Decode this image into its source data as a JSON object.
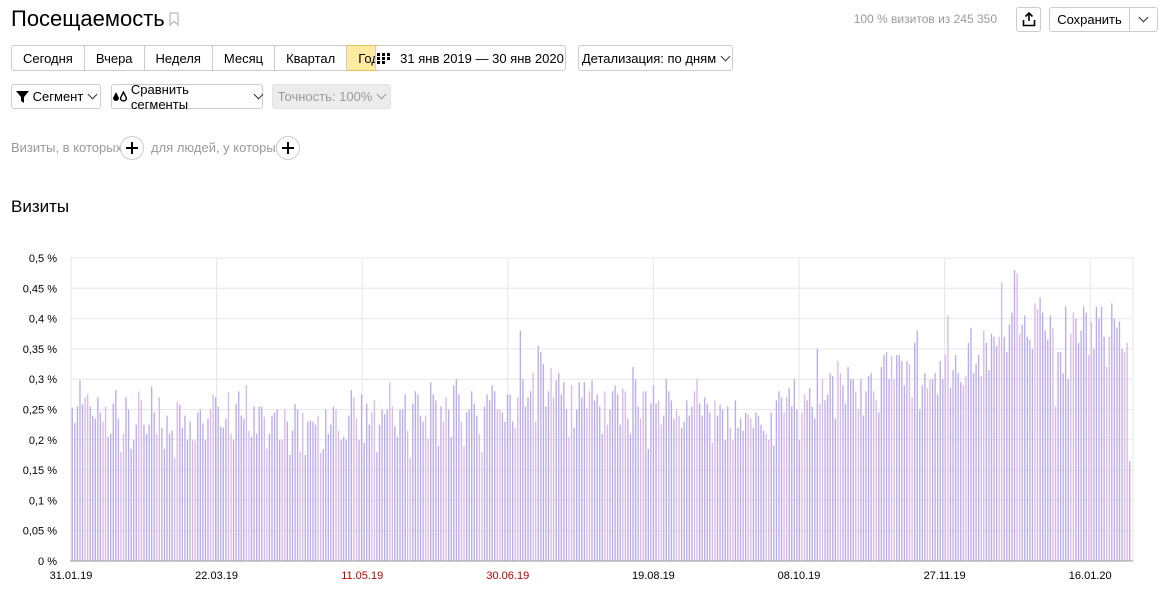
{
  "header": {
    "title": "Посещаемость",
    "visits_info": "100 % визитов из 245 350",
    "save_label": "Сохранить"
  },
  "periods": {
    "items": [
      {
        "label": "Сегодня",
        "active": false
      },
      {
        "label": "Вчера",
        "active": false
      },
      {
        "label": "Неделя",
        "active": false
      },
      {
        "label": "Месяц",
        "active": false
      },
      {
        "label": "Квартал",
        "active": false
      },
      {
        "label": "Год",
        "active": true
      }
    ]
  },
  "date_range": "31 янв 2019 — 30 янв 2020",
  "detail": "Детализация: по дням",
  "segment_label": "Сегмент",
  "compare_label": "Сравнить сегменты",
  "accuracy_label": "Точность: 100%",
  "filters": {
    "visits_label": "Визиты, в которых",
    "people_label": "для людей, у которых"
  },
  "section_title": "Визиты",
  "chart_data": {
    "type": "bar",
    "series": [
      {
        "name": "Визиты"
      }
    ],
    "y_unit": "%",
    "ylim": [
      0,
      0.5
    ],
    "yticks": [
      "0 %",
      "0,05 %",
      "0,1 %",
      "0,15 %",
      "0,2 %",
      "0,25 %",
      "0,3 %",
      "0,35 %",
      "0,4 %",
      "0,45 %",
      "0,5 %"
    ],
    "x_ticks": [
      {
        "label": "31.01.19",
        "holiday": false
      },
      {
        "label": "22.03.19",
        "holiday": false
      },
      {
        "label": "11.05.19",
        "holiday": true
      },
      {
        "label": "30.06.19",
        "holiday": true
      },
      {
        "label": "19.08.19",
        "holiday": false
      },
      {
        "label": "08.10.19",
        "holiday": false
      },
      {
        "label": "27.11.19",
        "holiday": false
      },
      {
        "label": "16.01.20",
        "holiday": false
      }
    ],
    "grid": true,
    "values": [
      0.253,
      0.228,
      0.255,
      0.298,
      0.258,
      0.27,
      0.275,
      0.255,
      0.24,
      0.235,
      0.27,
      0.245,
      0.23,
      0.255,
      0.205,
      0.21,
      0.26,
      0.282,
      0.235,
      0.18,
      0.21,
      0.27,
      0.25,
      0.185,
      0.2,
      0.225,
      0.28,
      0.265,
      0.225,
      0.21,
      0.225,
      0.288,
      0.245,
      0.21,
      0.27,
      0.22,
      0.185,
      0.24,
      0.21,
      0.215,
      0.17,
      0.262,
      0.258,
      0.22,
      0.24,
      0.2,
      0.23,
      0.2,
      0.198,
      0.245,
      0.25,
      0.227,
      0.2,
      0.235,
      0.25,
      0.275,
      0.27,
      0.255,
      0.222,
      0.22,
      0.235,
      0.278,
      0.21,
      0.2,
      0.26,
      0.28,
      0.24,
      0.235,
      0.29,
      0.215,
      0.205,
      0.255,
      0.21,
      0.255,
      0.255,
      0.238,
      0.185,
      0.21,
      0.24,
      0.245,
      0.25,
      0.2,
      0.2,
      0.25,
      0.23,
      0.175,
      0.215,
      0.259,
      0.25,
      0.18,
      0.245,
      0.175,
      0.23,
      0.232,
      0.23,
      0.225,
      0.24,
      0.178,
      0.185,
      0.25,
      0.21,
      0.225,
      0.255,
      0.25,
      0.215,
      0.2,
      0.205,
      0.2,
      0.24,
      0.282,
      0.27,
      0.235,
      0.2,
      0.275,
      0.195,
      0.26,
      0.225,
      0.245,
      0.265,
      0.18,
      0.225,
      0.25,
      0.242,
      0.25,
      0.295,
      0.255,
      0.222,
      0.205,
      0.25,
      0.25,
      0.275,
      0.215,
      0.17,
      0.26,
      0.28,
      0.275,
      0.24,
      0.23,
      0.24,
      0.202,
      0.295,
      0.275,
      0.265,
      0.19,
      0.255,
      0.23,
      0.27,
      0.25,
      0.205,
      0.29,
      0.3,
      0.275,
      0.23,
      0.19,
      0.245,
      0.25,
      0.28,
      0.26,
      0.24,
      0.21,
      0.18,
      0.255,
      0.275,
      0.265,
      0.29,
      0.28,
      0.25,
      0.25,
      0.245,
      0.23,
      0.275,
      0.275,
      0.23,
      0.22,
      0.27,
      0.38,
      0.3,
      0.255,
      0.27,
      0.28,
      0.31,
      0.23,
      0.355,
      0.345,
      0.325,
      0.255,
      0.28,
      0.318,
      0.27,
      0.298,
      0.31,
      0.275,
      0.295,
      0.25,
      0.205,
      0.29,
      0.22,
      0.25,
      0.295,
      0.27,
      0.295,
      0.252,
      0.28,
      0.298,
      0.265,
      0.275,
      0.255,
      0.21,
      0.28,
      0.225,
      0.25,
      0.28,
      0.29,
      0.275,
      0.225,
      0.285,
      0.28,
      0.235,
      0.21,
      0.32,
      0.3,
      0.255,
      0.235,
      0.28,
      0.28,
      0.185,
      0.26,
      0.29,
      0.26,
      0.265,
      0.225,
      0.24,
      0.3,
      0.28,
      0.265,
      0.235,
      0.25,
      0.24,
      0.22,
      0.23,
      0.265,
      0.24,
      0.255,
      0.28,
      0.3,
      0.26,
      0.24,
      0.27,
      0.26,
      0.245,
      0.195,
      0.265,
      0.24,
      0.258,
      0.25,
      0.2,
      0.255,
      0.22,
      0.2,
      0.265,
      0.22,
      0.235,
      0.215,
      0.245,
      0.242,
      0.235,
      0.22,
      0.245,
      0.24,
      0.225,
      0.215,
      0.21,
      0.2,
      0.245,
      0.19,
      0.265,
      0.28,
      0.27,
      0.245,
      0.27,
      0.285,
      0.255,
      0.3,
      0.25,
      0.2,
      0.245,
      0.275,
      0.265,
      0.285,
      0.255,
      0.235,
      0.35,
      0.26,
      0.3,
      0.265,
      0.275,
      0.31,
      0.305,
      0.235,
      0.33,
      0.31,
      0.29,
      0.26,
      0.32,
      0.3,
      0.3,
      0.28,
      0.25,
      0.3,
      0.24,
      0.28,
      0.305,
      0.31,
      0.28,
      0.265,
      0.245,
      0.32,
      0.34,
      0.345,
      0.3,
      0.338,
      0.3,
      0.34,
      0.34,
      0.33,
      0.29,
      0.33,
      0.325,
      0.27,
      0.36,
      0.38,
      0.25,
      0.29,
      0.31,
      0.285,
      0.3,
      0.3,
      0.31,
      0.275,
      0.33,
      0.3,
      0.34,
      0.405,
      0.285,
      0.315,
      0.34,
      0.31,
      0.295,
      0.29,
      0.305,
      0.36,
      0.385,
      0.31,
      0.325,
      0.34,
      0.305,
      0.38,
      0.36,
      0.315,
      0.375,
      0.37,
      0.355,
      0.37,
      0.46,
      0.37,
      0.345,
      0.39,
      0.41,
      0.48,
      0.475,
      0.375,
      0.39,
      0.405,
      0.37,
      0.365,
      0.35,
      0.425,
      0.415,
      0.435,
      0.41,
      0.38,
      0.365,
      0.405,
      0.385,
      0.255,
      0.345,
      0.345,
      0.31,
      0.42,
      0.3,
      0.375,
      0.41,
      0.4,
      0.36,
      0.38,
      0.42,
      0.41,
      0.34,
      0.395,
      0.35,
      0.42,
      0.4,
      0.42,
      0.37,
      0.32,
      0.37,
      0.425,
      0.4,
      0.385,
      0.395,
      0.35,
      0.345,
      0.36,
      0.165
    ]
  }
}
